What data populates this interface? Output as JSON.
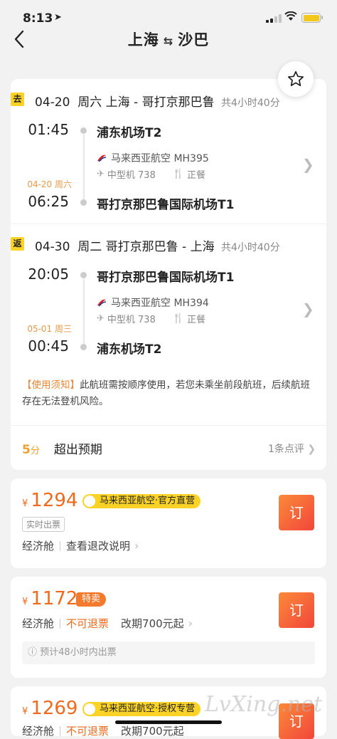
{
  "status": {
    "time": "8:13"
  },
  "nav": {
    "from": "上海",
    "swap": "⇆",
    "to": "沙巴"
  },
  "outbound": {
    "tag": "去",
    "date": "04-20",
    "weekday": "周六",
    "route": "上海 - 哥打京那巴鲁",
    "duration": "共4小时40分",
    "dep_time": "01:45",
    "dep_airport": "浦东机场T2",
    "airline": "马来西亚航空 MH395",
    "aircraft": "中型机 738",
    "meal": "正餐",
    "arr_date": "04-20 周六",
    "arr_time": "06:25",
    "arr_airport": "哥打京那巴鲁国际机场T1"
  },
  "inbound": {
    "tag": "返",
    "date": "04-30",
    "weekday": "周二",
    "route": "哥打京那巴鲁 - 上海",
    "duration": "共4小时40分",
    "dep_time": "20:05",
    "dep_airport": "哥打京那巴鲁国际机场T1",
    "airline": "马来西亚航空 MH394",
    "aircraft": "中型机 738",
    "meal": "正餐",
    "arr_date": "05-01 周三",
    "arr_time": "00:45",
    "arr_airport": "浦东机场T2"
  },
  "notice": {
    "label": "【使用须知】",
    "text": "此航班需按顺序使用，若您未乘坐前段航班，后续航班存在无法登机风险。"
  },
  "rating": {
    "score": "5",
    "unit": "分",
    "text": "超出预期",
    "reviews": "1条点评"
  },
  "offers": [
    {
      "currency": "¥",
      "price": "1294",
      "badge": "马来西亚航空·官方直营",
      "tag": "实时出票",
      "cabin": "经济舱",
      "policy": "查看退改说明",
      "book_label": "订"
    },
    {
      "currency": "¥",
      "price": "1172",
      "badge": "特卖",
      "cabin": "经济舱",
      "refund": "不可退票",
      "change": "改期700元起",
      "eta": "预计48小时内出票",
      "book_label": "订"
    },
    {
      "currency": "¥",
      "price": "1269",
      "badge": "马来西亚航空·授权专营",
      "cabin": "经济舱",
      "refund": "不可退票",
      "change": "改期700元起",
      "book_label": "订"
    }
  ],
  "watermark": "LvXing.net",
  "colors": {
    "accent": "#f06a1d",
    "yellow": "#fbd327",
    "book_gradient_start": "#fb8a3a",
    "book_gradient_end": "#f2463a"
  }
}
